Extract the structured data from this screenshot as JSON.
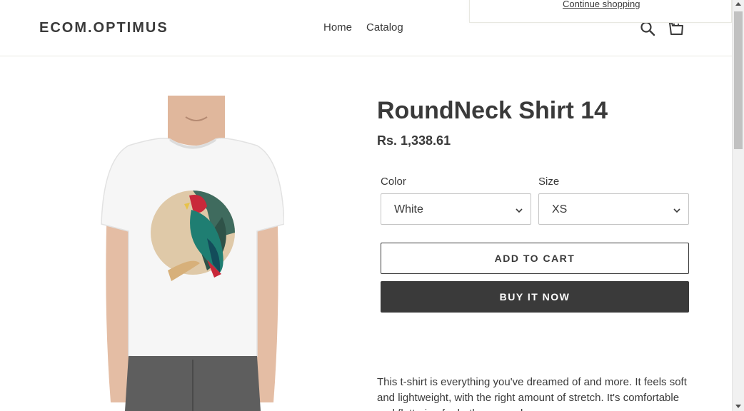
{
  "header": {
    "logo": "ECOM.OPTIMUS",
    "nav": [
      {
        "label": "Home"
      },
      {
        "label": "Catalog"
      }
    ],
    "search_icon": "search-icon",
    "cart_icon": "cart-icon"
  },
  "cart_popup": {
    "continue_label": "Continue shopping"
  },
  "product": {
    "title": "RoundNeck Shirt 14",
    "price": "Rs. 1,338.61",
    "image_alt": "Man wearing white t-shirt with parrot print",
    "options": {
      "color": {
        "label": "Color",
        "value": "White"
      },
      "size": {
        "label": "Size",
        "value": "XS"
      }
    },
    "add_to_cart_label": "ADD TO CART",
    "buy_now_label": "BUY IT NOW",
    "description": "This t-shirt is everything you've dreamed of and more. It feels soft and lightweight, with the right amount of stretch. It's comfortable and flattering for both men and women."
  },
  "colors": {
    "text": "#3a3a3a",
    "button_dark": "#3a3a3a",
    "border": "#c4c4c4"
  }
}
